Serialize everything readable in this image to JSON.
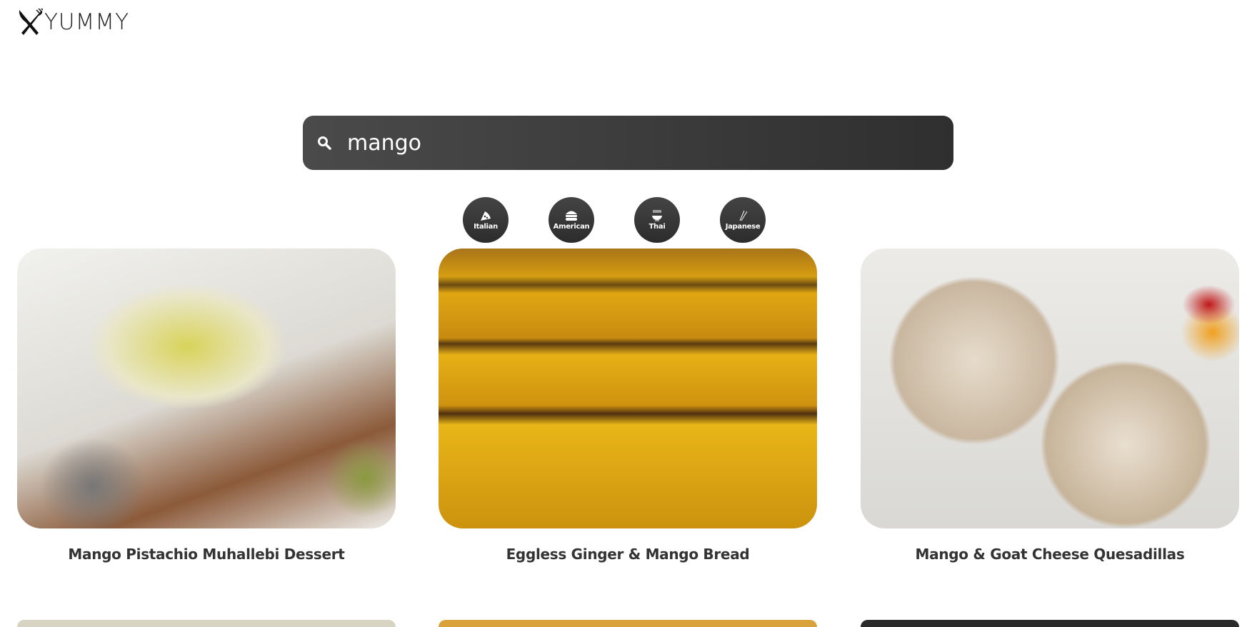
{
  "brand": {
    "name": "YUMMY",
    "icon": "fork-knife-icon"
  },
  "search": {
    "value": "mango",
    "icon": "search-icon"
  },
  "cuisines": [
    {
      "label": "Italian",
      "icon": "pizza-icon"
    },
    {
      "label": "American",
      "icon": "burger-icon"
    },
    {
      "label": "Thai",
      "icon": "noodle-bowl-icon"
    },
    {
      "label": "Japanese",
      "icon": "chopsticks-icon"
    }
  ],
  "recipes": [
    {
      "title": "Mango Pistachio Muhallebi Dessert"
    },
    {
      "title": "Eggless Ginger & Mango Bread"
    },
    {
      "title": "Mango & Goat Cheese Quesadillas"
    }
  ]
}
